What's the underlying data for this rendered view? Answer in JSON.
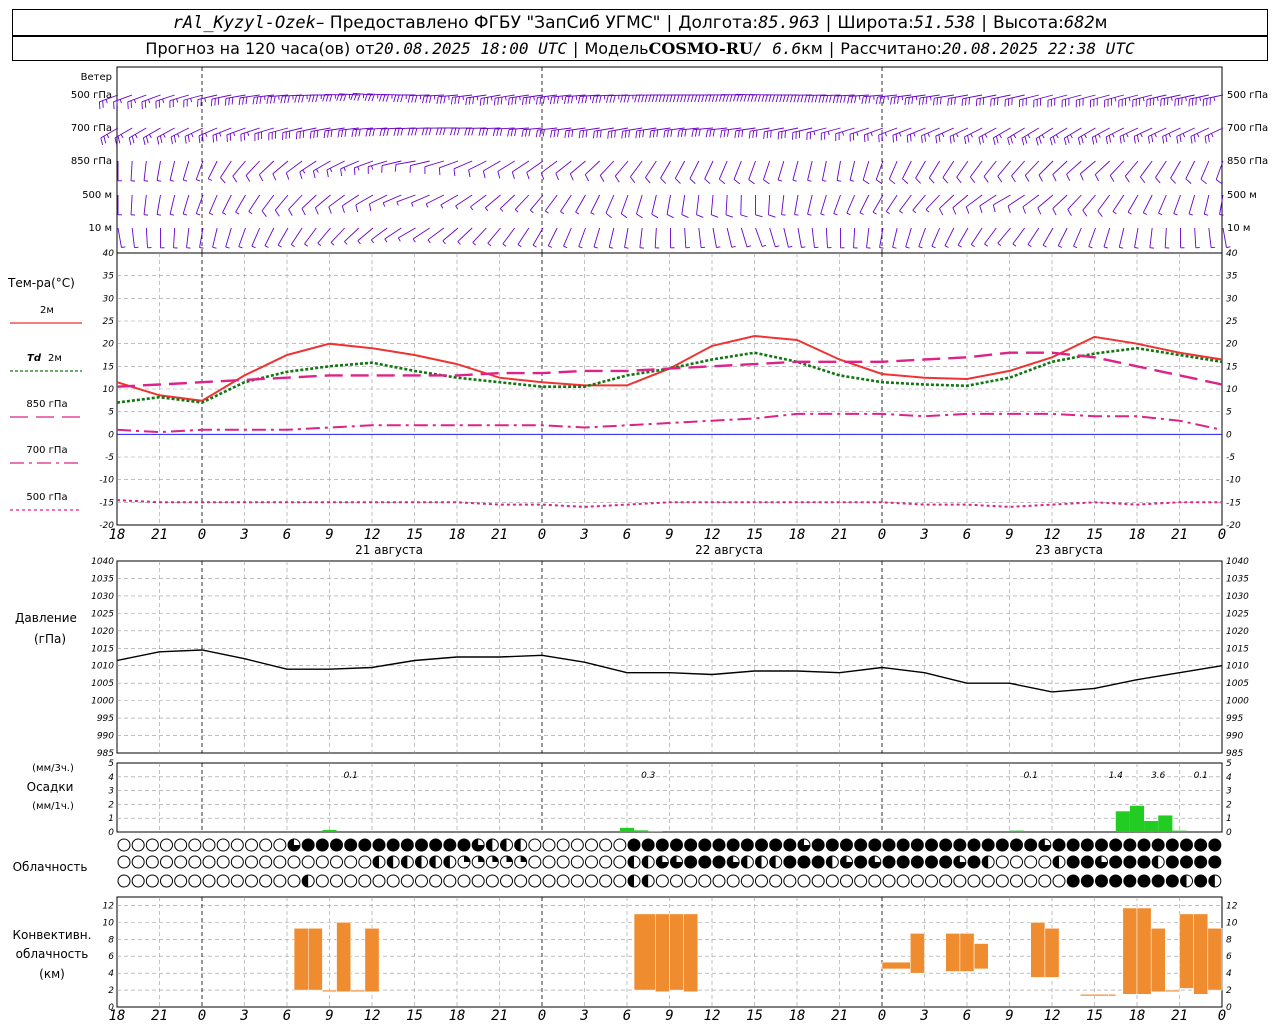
{
  "header": {
    "station": "rAl_Kyzyl-Ozek",
    "provider": "– Предоставлено ФГБУ \"ЗапСиб УГМС\"",
    "lon_label": "Долгота:",
    "lon_value": "85.963",
    "lat_label": "Широта:",
    "lat_value": "51.538",
    "alt_label": "Высота:",
    "alt_value": "682",
    "alt_unit": "м",
    "forecast_prefix": "Прогноз на 120 часа(ов) от",
    "forecast_time": "20.08.2025 18:00 UTC",
    "model_prefix": "Модель",
    "model_name": "COSMO-RU",
    "model_res": "/ 6.6",
    "model_res_unit": "км",
    "computed_label": "Рассчитано:",
    "computed_time": "20.08.2025 22:38 UTC"
  },
  "colors": {
    "t2m": "#ee3333",
    "td2m": "#117711",
    "t850": "#dd2288",
    "t700": "#dd2288",
    "t500": "#dd2288",
    "wind": "#6a00c8",
    "pressure": "#000000",
    "precip": "#22cc22",
    "convective": "#f08c30",
    "zero_line": "#0000ff"
  },
  "wind_panel": {
    "title": "Ветер",
    "levels": [
      "500 гПа",
      "700 гПа",
      "850 гПа",
      "500 м",
      "10 м"
    ]
  },
  "temp_panel": {
    "title": "Тем-ра(°С)",
    "legend": [
      {
        "key": "t2m",
        "label": "2м",
        "prefix": ""
      },
      {
        "key": "td2m",
        "label": "2м",
        "prefix": "Td"
      },
      {
        "key": "t850",
        "label": "850 гПа",
        "prefix": ""
      },
      {
        "key": "t700",
        "label": "700 гПа",
        "prefix": ""
      },
      {
        "key": "t500",
        "label": "500 гПа",
        "prefix": ""
      }
    ]
  },
  "pressure_panel": {
    "title": "Давление",
    "unit": "(гПа)"
  },
  "precip_panel": {
    "unit_top": "(мм/3ч.)",
    "title": "Осадки",
    "unit_bottom": "(мм/1ч.)"
  },
  "cloud_panel": {
    "title": "Облачность"
  },
  "conv_panel": {
    "line1": "Конвективн.",
    "line2": "облачность",
    "line3": "(км)"
  },
  "x_axis": {
    "hour_labels": [
      "18",
      "21",
      "0",
      "3",
      "6",
      "9",
      "12",
      "15",
      "18",
      "21",
      "0",
      "3",
      "6",
      "9",
      "12",
      "15",
      "18",
      "21",
      "0",
      "3",
      "6",
      "9",
      "12",
      "15",
      "18",
      "21",
      "0"
    ],
    "day_labels": [
      "21 августа",
      "22 августа",
      "23 августа"
    ]
  },
  "chart_data": [
    {
      "type": "line",
      "title": "Тем-ра(°С)",
      "x_hours": [
        0,
        3,
        6,
        9,
        12,
        15,
        18,
        21,
        24,
        27,
        30,
        33,
        36,
        39,
        42,
        45,
        48,
        51,
        54,
        57,
        60,
        63,
        66,
        69,
        72,
        75,
        78
      ],
      "ylim": [
        -20,
        40
      ],
      "yticks": [
        -20,
        -15,
        -10,
        -5,
        0,
        5,
        10,
        15,
        20,
        25,
        30,
        35,
        40
      ],
      "grid": true,
      "series": [
        {
          "name": "2м",
          "key": "t2m",
          "values": [
            11.5,
            8.6,
            7.4,
            13,
            17.5,
            20,
            19,
            17.5,
            15.5,
            12.5,
            11.5,
            10.8,
            10.8,
            14.5,
            19.5,
            21.7,
            20.8,
            16.5,
            13.3,
            12.5,
            12.2,
            14,
            17,
            21.5,
            20,
            18,
            16.5
          ]
        },
        {
          "name": "Td 2м",
          "key": "td2m",
          "values": [
            7,
            8.2,
            7,
            11.5,
            13.8,
            15,
            15.8,
            14,
            12.5,
            11.5,
            10.5,
            10.5,
            13,
            14.5,
            16.5,
            18,
            16,
            13,
            11.5,
            11,
            10.7,
            12.5,
            16,
            17.8,
            19,
            17.5,
            16
          ]
        },
        {
          "name": "850 гПа",
          "key": "t850",
          "values": [
            10.5,
            11,
            11.5,
            12,
            12.5,
            13,
            13,
            13,
            13,
            13.5,
            13.5,
            14,
            14,
            14.5,
            15,
            15.5,
            16,
            16,
            16,
            16.5,
            17,
            18,
            18,
            17,
            15,
            13,
            11
          ]
        },
        {
          "name": "700 гПа",
          "key": "t700",
          "values": [
            1,
            0.5,
            1,
            1,
            1,
            1.5,
            2,
            2,
            2,
            2,
            2,
            1.5,
            2,
            2.5,
            3,
            3.5,
            4.5,
            4.5,
            4.5,
            4,
            4.5,
            4.5,
            4.5,
            4,
            4,
            3,
            1
          ]
        },
        {
          "name": "500 гПа",
          "key": "t500",
          "values": [
            -14.5,
            -15,
            -15,
            -15,
            -15,
            -15,
            -15,
            -15,
            -15,
            -15.5,
            -15.5,
            -16,
            -15.5,
            -15,
            -15,
            -15,
            -15,
            -15,
            -15,
            -15.5,
            -15.5,
            -16,
            -15.5,
            -15,
            -15.5,
            -15,
            -15
          ]
        }
      ]
    },
    {
      "type": "line",
      "title": "Давление",
      "ylabel": "(гПа)",
      "x_hours": [
        0,
        3,
        6,
        9,
        12,
        15,
        18,
        21,
        24,
        27,
        30,
        33,
        36,
        39,
        42,
        45,
        48,
        51,
        54,
        57,
        60,
        63,
        66,
        69,
        72,
        75,
        78
      ],
      "ylim": [
        985,
        1040
      ],
      "yticks": [
        985,
        990,
        995,
        1000,
        1005,
        1010,
        1015,
        1020,
        1025,
        1030,
        1035,
        1040
      ],
      "grid": true,
      "series": [
        {
          "name": "Давление",
          "key": "pressure",
          "values": [
            1011.5,
            1014,
            1014.5,
            1012,
            1009,
            1009,
            1009.5,
            1011.5,
            1012.5,
            1012.5,
            1013,
            1011,
            1008,
            1008,
            1007.5,
            1008.5,
            1008.5,
            1008,
            1009.5,
            1008,
            1005,
            1005,
            1002.5,
            1003.5,
            1006,
            1008,
            1010
          ]
        }
      ]
    },
    {
      "type": "bar",
      "title": "Осадки",
      "ylim": [
        0,
        5
      ],
      "yticks": [
        0,
        1,
        2,
        3,
        4,
        5
      ],
      "totals_3h": [
        {
          "x_hour": 16.5,
          "text": "0.1"
        },
        {
          "x_hour": 37.5,
          "text": "0.3"
        },
        {
          "x_hour": 64.5,
          "text": "0.1"
        },
        {
          "x_hour": 70.5,
          "text": "1.4"
        },
        {
          "x_hour": 73.5,
          "text": "3.6"
        },
        {
          "x_hour": 76.5,
          "text": "0.1"
        }
      ],
      "hourly": [
        {
          "x_hour": 15,
          "value": 0.15
        },
        {
          "x_hour": 36,
          "value": 0.3
        },
        {
          "x_hour": 37,
          "value": 0.12
        },
        {
          "x_hour": 38,
          "value": 0.05
        },
        {
          "x_hour": 63.5,
          "value": 0.1
        },
        {
          "x_hour": 71,
          "value": 1.5
        },
        {
          "x_hour": 72,
          "value": 1.9
        },
        {
          "x_hour": 73,
          "value": 0.8
        },
        {
          "x_hour": 74,
          "value": 1.2
        },
        {
          "x_hour": 75,
          "value": 0.1
        }
      ]
    },
    {
      "type": "bar",
      "title": "Конвективн. облачность (км)",
      "ylim": [
        0,
        13
      ],
      "yticks": [
        0,
        2,
        4,
        6,
        8,
        10,
        12
      ],
      "bars": [
        {
          "x0": 12.5,
          "x1": 13.5,
          "base": 2,
          "top": 9.3
        },
        {
          "x0": 13.5,
          "x1": 14.5,
          "base": 2,
          "top": 9.3
        },
        {
          "x0": 14.5,
          "x1": 15.5,
          "base": 1.8,
          "top": 2
        },
        {
          "x0": 15.5,
          "x1": 16.5,
          "base": 1.8,
          "top": 10
        },
        {
          "x0": 16.5,
          "x1": 17.5,
          "base": 1.8,
          "top": 2
        },
        {
          "x0": 17.5,
          "x1": 18.5,
          "base": 1.8,
          "top": 9.3
        },
        {
          "x0": 36.5,
          "x1": 38,
          "base": 2,
          "top": 11
        },
        {
          "x0": 38,
          "x1": 39,
          "base": 1.8,
          "top": 11
        },
        {
          "x0": 39,
          "x1": 40,
          "base": 2,
          "top": 11
        },
        {
          "x0": 40,
          "x1": 41,
          "base": 1.8,
          "top": 11
        },
        {
          "x0": 54,
          "x1": 56,
          "base": 4.5,
          "top": 5.3
        },
        {
          "x0": 56,
          "x1": 57,
          "base": 4,
          "top": 8.7
        },
        {
          "x0": 58.5,
          "x1": 59.5,
          "base": 4.2,
          "top": 8.7
        },
        {
          "x0": 59.5,
          "x1": 60.5,
          "base": 4.2,
          "top": 8.7
        },
        {
          "x0": 60.5,
          "x1": 61.5,
          "base": 4.5,
          "top": 7.5
        },
        {
          "x0": 64.5,
          "x1": 65.5,
          "base": 3.5,
          "top": 10
        },
        {
          "x0": 65.5,
          "x1": 66.5,
          "base": 3.5,
          "top": 9.3
        },
        {
          "x0": 68,
          "x1": 70,
          "base": 1.3,
          "top": 1.5
        },
        {
          "x0": 70,
          "x1": 70.5,
          "base": 1.3,
          "top": 1.5
        },
        {
          "x0": 71,
          "x1": 72,
          "base": 1.5,
          "top": 11.7
        },
        {
          "x0": 72,
          "x1": 73,
          "base": 1.5,
          "top": 11.7
        },
        {
          "x0": 73,
          "x1": 74,
          "base": 1.8,
          "top": 9.3
        },
        {
          "x0": 74,
          "x1": 75,
          "base": 1.8,
          "top": 2
        },
        {
          "x0": 75,
          "x1": 76,
          "base": 2.2,
          "top": 11
        },
        {
          "x0": 76,
          "x1": 77,
          "base": 1.5,
          "top": 11
        },
        {
          "x0": 77,
          "x1": 78,
          "base": 2,
          "top": 9.3
        }
      ]
    }
  ],
  "clouds": {
    "row_count": 3,
    "symbols_per_row": 78,
    "legend_codes": "0 clear, 1 quarter, 2 half, 3 three-quarter, 4 overcast",
    "rows": [
      [
        0,
        0,
        0,
        0,
        0,
        0,
        0,
        0,
        0,
        0,
        0,
        0,
        3,
        4,
        4,
        4,
        4,
        4,
        4,
        4,
        4,
        4,
        4,
        4,
        4,
        3,
        2,
        2,
        2,
        0,
        0,
        0,
        0,
        0,
        0,
        0,
        4,
        4,
        4,
        4,
        4,
        4,
        4,
        4,
        4,
        4,
        4,
        4,
        3,
        4,
        4,
        4,
        4,
        4,
        4,
        4,
        4,
        4,
        4,
        4,
        4,
        4,
        4,
        4,
        4,
        3,
        4,
        4,
        4,
        4,
        4,
        4,
        4,
        4,
        4,
        4,
        4,
        4
      ],
      [
        0,
        0,
        0,
        0,
        0,
        0,
        0,
        0,
        0,
        0,
        0,
        0,
        0,
        0,
        0,
        0,
        0,
        0,
        2,
        2,
        2,
        2,
        2,
        2,
        1,
        1,
        1,
        1,
        1,
        0,
        0,
        0,
        0,
        0,
        0,
        0,
        2,
        2,
        3,
        3,
        4,
        4,
        4,
        3,
        2,
        2,
        2,
        4,
        4,
        4,
        2,
        3,
        4,
        3,
        4,
        4,
        4,
        4,
        4,
        3,
        4,
        2,
        0,
        0,
        0,
        0,
        2,
        4,
        4,
        3,
        4,
        4,
        4,
        2,
        4,
        4,
        4,
        4
      ],
      [
        0,
        0,
        0,
        0,
        0,
        0,
        0,
        0,
        0,
        0,
        0,
        0,
        0,
        2,
        0,
        0,
        0,
        0,
        0,
        0,
        0,
        0,
        0,
        0,
        0,
        0,
        0,
        0,
        0,
        0,
        0,
        0,
        0,
        0,
        0,
        0,
        2,
        2,
        0,
        0,
        0,
        0,
        0,
        0,
        0,
        0,
        0,
        0,
        0,
        0,
        0,
        0,
        0,
        0,
        0,
        0,
        0,
        0,
        0,
        0,
        0,
        0,
        0,
        0,
        0,
        0,
        0,
        4,
        4,
        4,
        4,
        4,
        4,
        4,
        4,
        2,
        4,
        2
      ]
    ]
  },
  "winds": {
    "row_keys": [
      "500 гПа",
      "700 гПа",
      "850 гПа",
      "500 м",
      "10 м"
    ],
    "direction_deg": [
      [
        250,
        250,
        255,
        260,
        265,
        270,
        275,
        270,
        265,
        260,
        262,
        265,
        268,
        270,
        270,
        272,
        270,
        268,
        265,
        262,
        260,
        258,
        255,
        255,
        255,
        258,
        258
      ],
      [
        240,
        240,
        245,
        250,
        255,
        260,
        265,
        268,
        270,
        268,
        265,
        262,
        260,
        262,
        265,
        262,
        258,
        255,
        250,
        248,
        245,
        240,
        238,
        240,
        245,
        245,
        245
      ],
      [
        180,
        190,
        200,
        220,
        230,
        240,
        250,
        260,
        250,
        240,
        235,
        230,
        220,
        210,
        205,
        200,
        195,
        190,
        200,
        210,
        215,
        220,
        225,
        230,
        220,
        210,
        200
      ],
      [
        180,
        190,
        200,
        210,
        220,
        230,
        240,
        250,
        240,
        230,
        220,
        210,
        200,
        190,
        185,
        180,
        190,
        200,
        210,
        220,
        230,
        240,
        230,
        220,
        210,
        200,
        190
      ],
      [
        170,
        180,
        190,
        200,
        210,
        220,
        230,
        240,
        230,
        220,
        210,
        200,
        190,
        180,
        170,
        160,
        170,
        180,
        190,
        200,
        210,
        220,
        210,
        200,
        190,
        180,
        170
      ]
    ],
    "speed_kt": [
      [
        25,
        25,
        25,
        30,
        35,
        35,
        35,
        35,
        35,
        35,
        35,
        35,
        35,
        40,
        40,
        40,
        40,
        40,
        35,
        35,
        30,
        30,
        30,
        30,
        35,
        35,
        35
      ],
      [
        25,
        25,
        25,
        25,
        30,
        30,
        30,
        30,
        30,
        30,
        30,
        30,
        30,
        30,
        30,
        30,
        30,
        25,
        25,
        25,
        25,
        25,
        25,
        25,
        25,
        25,
        25
      ],
      [
        5,
        5,
        5,
        10,
        10,
        15,
        15,
        10,
        10,
        10,
        10,
        10,
        10,
        10,
        10,
        10,
        5,
        5,
        10,
        10,
        10,
        10,
        10,
        10,
        10,
        10,
        10
      ],
      [
        5,
        5,
        5,
        5,
        10,
        10,
        10,
        5,
        5,
        5,
        5,
        5,
        10,
        10,
        10,
        10,
        5,
        5,
        5,
        5,
        10,
        10,
        10,
        10,
        5,
        5,
        5
      ],
      [
        5,
        5,
        5,
        5,
        5,
        5,
        5,
        5,
        5,
        5,
        5,
        5,
        5,
        5,
        5,
        5,
        5,
        5,
        5,
        5,
        5,
        5,
        5,
        5,
        5,
        5,
        5
      ]
    ]
  }
}
